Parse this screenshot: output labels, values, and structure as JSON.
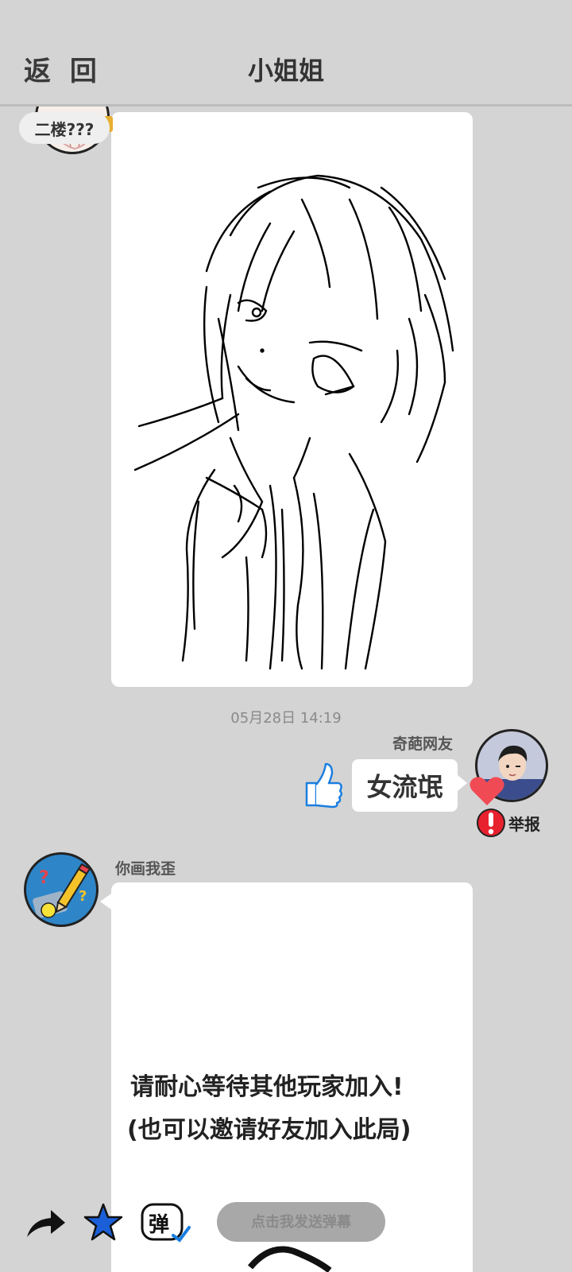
{
  "header": {
    "back_label": "返 回",
    "title": "小姐姐"
  },
  "first_message": {
    "floor_label": "二楼???"
  },
  "timestamp": "05月28日  14:19",
  "reply": {
    "username": "奇葩网友",
    "text": "女流氓",
    "report_label": "举报",
    "heart_color": "#f04b55",
    "like_color": "#1a7ee0"
  },
  "host_message": {
    "username": "你画我歪",
    "line1": "请耐心等待其他玩家加入!",
    "line2": "(也可以邀请好友加入此局)"
  },
  "bottom_bar": {
    "danmaku_placeholder": "点击我发送弹幕",
    "danmaku_icon_char": "弹",
    "star_color": "#1a5fd8"
  }
}
